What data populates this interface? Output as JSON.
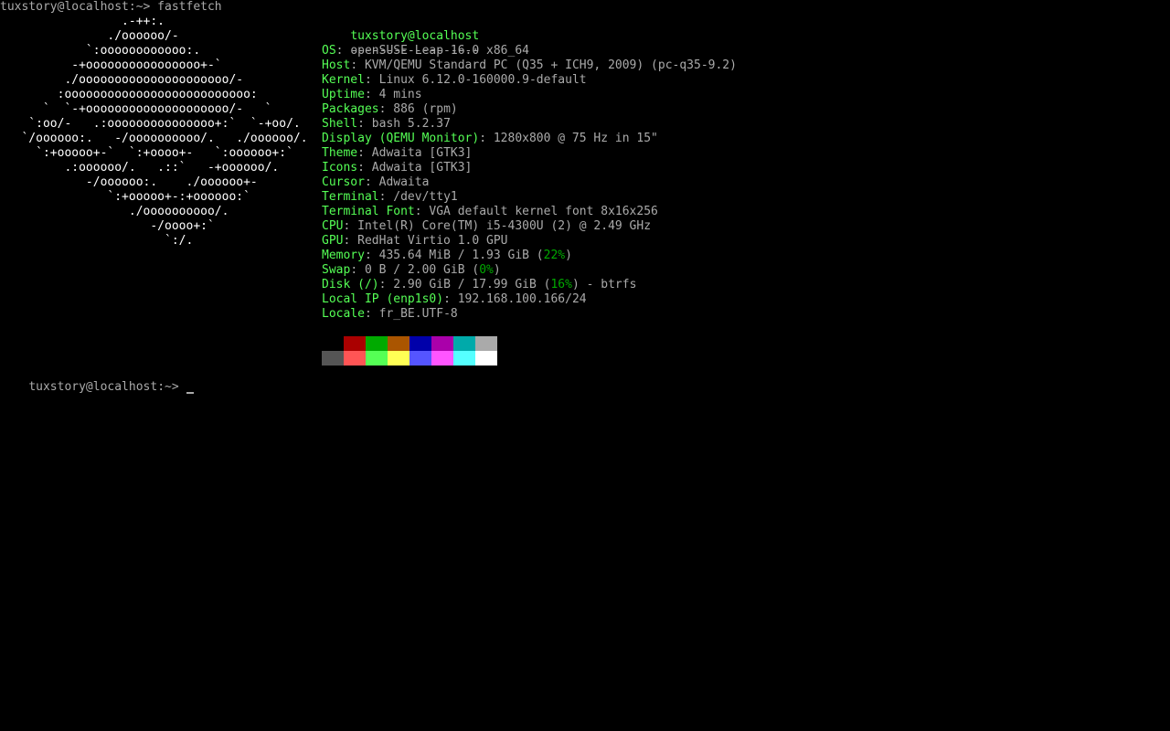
{
  "terminal": {
    "first_prompt": "tuxstory@localhost:~> fastfetch",
    "second_prompt": "tuxstory@localhost:~> "
  },
  "logo_lines": [
    "                 .-++:.",
    "               ./oooooo/-",
    "            `:oooooooooooo:.",
    "          -+oooooooooooooooo+-`",
    "         ./ooooooooooooooooooooo/-",
    "        :oooooooooooooooooooooooooo:",
    "      `  `-+oooooooooooooooooooo/-   `",
    "    `:oo/-   .:ooooooooooooooo+:`  `-+oo/.",
    "   `/oooooo:.   -/oooooooooo/.   ./oooooo/.",
    "     `:+ooooo+-`  `:+oooo+-   `:oooooo+:`",
    "         .:oooooo/.   .::`   -+oooooo/.",
    "            -/oooooo:.    ./oooooo+-",
    "               `:+ooooo+-:+oooooo:`",
    "                  ./oooooooooo/.",
    "                     -/oooo+:`",
    "                       `:/."
  ],
  "info": {
    "user_host": "tuxstory@localhost",
    "separator": "------------------",
    "rows": [
      {
        "key": "OS",
        "value": "openSUSE Leap 16.0 x86_64"
      },
      {
        "key": "Host",
        "value": "KVM/QEMU Standard PC (Q35 + ICH9, 2009) (pc-q35-9.2)"
      },
      {
        "key": "Kernel",
        "value": "Linux 6.12.0-160000.9-default"
      },
      {
        "key": "Uptime",
        "value": "4 mins"
      },
      {
        "key": "Packages",
        "value": "886 (rpm)"
      },
      {
        "key": "Shell",
        "value": "bash 5.2.37"
      },
      {
        "key": "Display (QEMU Monitor)",
        "value": "1280x800 @ 75 Hz in 15\""
      },
      {
        "key": "Theme",
        "value": "Adwaita [GTK3]"
      },
      {
        "key": "Icons",
        "value": "Adwaita [GTK3]"
      },
      {
        "key": "Cursor",
        "value": "Adwaita"
      },
      {
        "key": "Terminal",
        "value": "/dev/tty1"
      },
      {
        "key": "Terminal Font",
        "value": "VGA default kernel font 8x16x256"
      },
      {
        "key": "CPU",
        "value": "Intel(R) Core(TM) i5-4300U (2) @ 2.49 GHz"
      },
      {
        "key": "GPU",
        "value": "RedHat Virtio 1.0 GPU"
      },
      {
        "key": "Memory",
        "value_pre": "435.64 MiB / 1.93 GiB (",
        "pct": "22%",
        "value_post": ")"
      },
      {
        "key": "Swap",
        "value_pre": "0 B / 2.00 GiB (",
        "pct": "0%",
        "value_post": ")"
      },
      {
        "key": "Disk (/)",
        "value_pre": "2.90 GiB / 17.99 GiB (",
        "pct": "16%",
        "value_post": ") - btrfs"
      },
      {
        "key": "Local IP (enp1s0)",
        "value": "192.168.100.166/24"
      },
      {
        "key": "Locale",
        "value": "fr_BE.UTF-8"
      }
    ]
  },
  "palette": {
    "normal": [
      "#000000",
      "#aa0000",
      "#00aa00",
      "#aa5500",
      "#0000aa",
      "#aa00aa",
      "#00aaaa",
      "#aaaaaa"
    ],
    "bright": [
      "#555555",
      "#ff5555",
      "#55ff55",
      "#ffff55",
      "#5555ff",
      "#ff55ff",
      "#55ffff",
      "#ffffff"
    ]
  },
  "colors": {
    "background": "#000000",
    "foreground": "#aaaaaa",
    "key": "#55ff55",
    "percent": "#00aa00"
  }
}
